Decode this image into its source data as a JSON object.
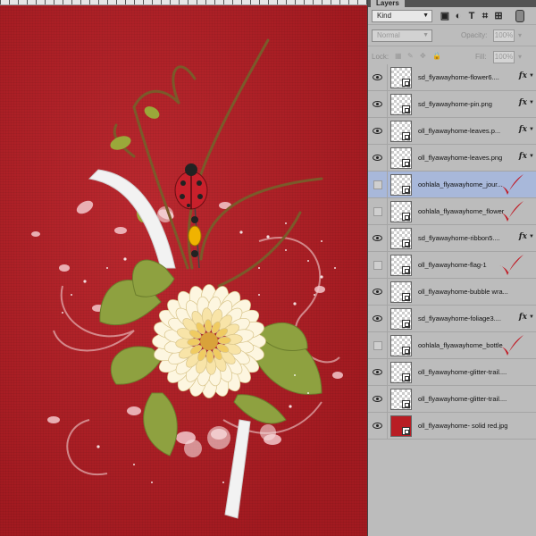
{
  "canvas": {
    "background_color": "#b81d24",
    "artwork": [
      "flower",
      "leaves",
      "ladybug",
      "pin",
      "ribbon",
      "branches",
      "glitter-trail",
      "bubbles"
    ]
  },
  "panel": {
    "tab_label": "Layers",
    "filter": {
      "value": "Kind",
      "icons": [
        "image-filter-icon",
        "adjustment-filter-icon",
        "text-filter-icon",
        "shape-filter-icon",
        "smart-object-filter-icon",
        "filter-toggle-icon"
      ]
    },
    "blend_mode": "Normal",
    "opacity_label": "Opacity:",
    "opacity_value": "100%",
    "lock_label": "Lock:",
    "fill_label": "Fill:",
    "fill_value": "100%",
    "check_color": "#c01822",
    "selection_color": "#a8b8da"
  },
  "layers": [
    {
      "name": "sd_flyawayhome-flower6....",
      "visible": true,
      "fx": true,
      "checked": false,
      "selected": false
    },
    {
      "name": "sd_flyawayhome-pin.png",
      "visible": true,
      "fx": true,
      "checked": false,
      "selected": false
    },
    {
      "name": "oll_flyawayhome-leaves.p...",
      "visible": true,
      "fx": true,
      "checked": false,
      "selected": false
    },
    {
      "name": "oll_flyawayhome-leaves.png",
      "visible": true,
      "fx": true,
      "checked": false,
      "selected": false
    },
    {
      "name": "oohlala_flyawayhome_jour...",
      "visible": false,
      "fx": false,
      "checked": true,
      "selected": true
    },
    {
      "name": "oohlala_flyawayhome_flower",
      "visible": false,
      "fx": false,
      "checked": true,
      "selected": false
    },
    {
      "name": "sd_flyawayhome-ribbon5....",
      "visible": true,
      "fx": true,
      "checked": false,
      "selected": false
    },
    {
      "name": "oll_flyawayhome-flag-1",
      "visible": false,
      "fx": false,
      "checked": true,
      "selected": false
    },
    {
      "name": "oll_flyawayhome-bubble wra...",
      "visible": true,
      "fx": false,
      "checked": false,
      "selected": false
    },
    {
      "name": "sd_flyawayhome-foliage3....",
      "visible": true,
      "fx": true,
      "checked": false,
      "selected": false
    },
    {
      "name": "oohlala_flyawayhome_bottle",
      "visible": false,
      "fx": false,
      "checked": true,
      "selected": false
    },
    {
      "name": "oll_flyawayhome-glitter-trail....",
      "visible": true,
      "fx": false,
      "checked": false,
      "selected": false
    },
    {
      "name": "oll_flyawayhome-glitter-trail....",
      "visible": true,
      "fx": false,
      "checked": false,
      "selected": false
    },
    {
      "name": "oll_flyawayhome- solid red.jpg",
      "visible": true,
      "fx": false,
      "checked": false,
      "selected": false,
      "thumb": "red"
    }
  ]
}
